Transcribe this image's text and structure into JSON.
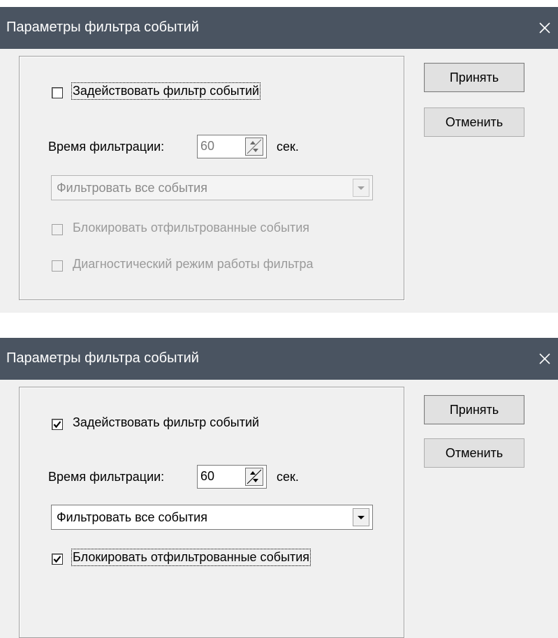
{
  "dialogs": [
    {
      "title": "Параметры фильтра событий",
      "enable_filter": {
        "label": "Задействовать фильтр событий",
        "checked": false
      },
      "filter_time": {
        "label": "Время фильтрации:",
        "value": "60",
        "unit": "сек."
      },
      "filter_mode": {
        "selected": "Фильтровать все события"
      },
      "block_filtered": {
        "label": "Блокировать отфильтрованные события",
        "checked": false
      },
      "diagnostic_mode": {
        "label": "Диагностический режим работы фильтра",
        "checked": false
      },
      "accept_label": "Принять",
      "cancel_label": "Отменить"
    },
    {
      "title": "Параметры фильтра событий",
      "enable_filter": {
        "label": "Задействовать фильтр событий",
        "checked": true
      },
      "filter_time": {
        "label": "Время фильтрации:",
        "value": "60",
        "unit": "сек."
      },
      "filter_mode": {
        "selected": "Фильтровать все события"
      },
      "block_filtered": {
        "label": "Блокировать отфильтрованные события",
        "checked": true
      },
      "accept_label": "Принять",
      "cancel_label": "Отменить"
    }
  ],
  "icons": {
    "close": "close-icon",
    "check": "check-icon",
    "spin": "spin-arrows-icon",
    "dropdown": "dropdown-arrow-icon"
  },
  "colors": {
    "titlebar": "#4a5461",
    "dialog_bg": "#f0f0f0",
    "disabled_text": "#9a9a9a"
  }
}
